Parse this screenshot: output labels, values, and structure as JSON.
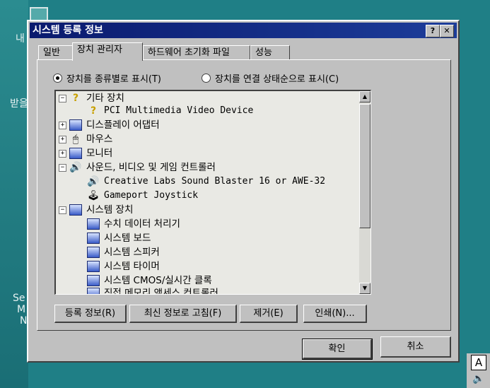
{
  "desktop": {
    "labels": [
      "내",
      "받을",
      "Se",
      "M",
      "N"
    ]
  },
  "window": {
    "title": "시스템 등록 정보",
    "help": "?",
    "close": "✕"
  },
  "tabs": [
    {
      "label": "일반"
    },
    {
      "label": "장치 관리자"
    },
    {
      "label": "하드웨어 초기화 파일"
    },
    {
      "label": "성능"
    }
  ],
  "view_options": {
    "by_type": "장치를 종류별로 표시(T)",
    "by_connection": "장치를 연결 상태순으로 표시(C)",
    "selected": "by_type"
  },
  "tree": [
    {
      "label": "기타 장치",
      "expander": "−",
      "icon": "question"
    },
    {
      "label": "PCI Multimedia Video Device",
      "icon": "question"
    },
    {
      "label": "디스플레이 어댑터",
      "expander": "+",
      "icon": "display"
    },
    {
      "label": "마우스",
      "expander": "+",
      "icon": "mouse"
    },
    {
      "label": "모니터",
      "expander": "+",
      "icon": "monitor"
    },
    {
      "label": "사운드, 비디오 및 게임 컨트롤러",
      "expander": "−",
      "icon": "sound"
    },
    {
      "label": "Creative Labs Sound Blaster 16 or AWE-32",
      "icon": "sound"
    },
    {
      "label": "Gameport Joystick",
      "icon": "joystick"
    },
    {
      "label": "시스템 장치",
      "expander": "−",
      "icon": "computer"
    },
    {
      "label": "수치 데이터 처리기",
      "icon": "computer"
    },
    {
      "label": "시스템 보드",
      "icon": "computer"
    },
    {
      "label": "시스템 스피커",
      "icon": "computer"
    },
    {
      "label": "시스템 타이머",
      "icon": "computer"
    },
    {
      "label": "시스템 CMOS/실시간 클록",
      "icon": "computer"
    },
    {
      "label": "직접 메모리 액세스 컨트롤러",
      "icon": "computer"
    }
  ],
  "actions": {
    "properties": "등록 정보(R)",
    "refresh": "최신 정보로 고침(F)",
    "remove": "제거(E)",
    "print": "인쇄(N)..."
  },
  "footer": {
    "ok": "확인",
    "cancel": "취소"
  },
  "tray": {
    "ime": "A"
  }
}
